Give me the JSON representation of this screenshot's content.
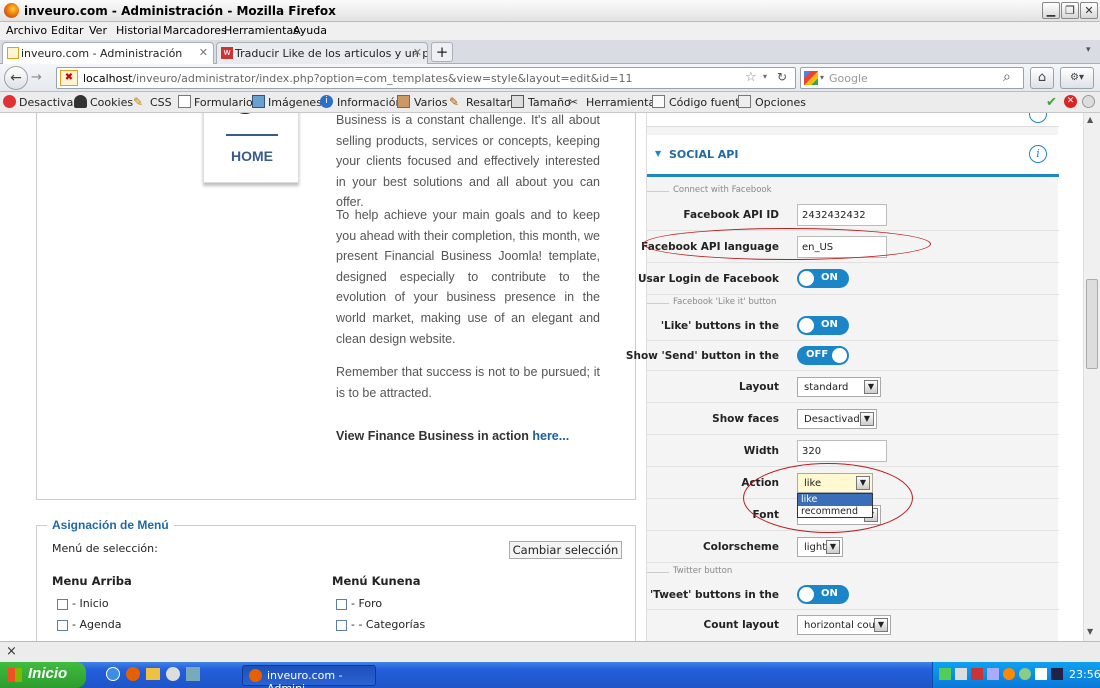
{
  "window": {
    "title": "inveuro.com - Administración - Mozilla Firefox"
  },
  "menubar": [
    "Archivo",
    "Editar",
    "Ver",
    "Historial",
    "Marcadores",
    "Herramientas",
    "Ayuda"
  ],
  "tabs": [
    {
      "label": "inveuro.com - Administración",
      "active": true
    },
    {
      "label": "Traducir Like de los articulos y un par det...",
      "active": false
    }
  ],
  "nav": {
    "url_host": "localhost",
    "url_path": "/inveuro/administrator/index.php?option=com_templates&view=style&layout=edit&id=11",
    "search_placeholder": "Google"
  },
  "toolbar": [
    "Desactivar",
    "Cookies",
    "CSS",
    "Formularios",
    "Imágenes",
    "Información",
    "Varios",
    "Resaltar",
    "Tamaño",
    "Herramientas",
    "Código fuente",
    "Opciones"
  ],
  "left": {
    "home_label": "HOME",
    "para1": "Business is a constant challenge. It's all about selling products, services or concepts, keeping your clients focused and effectively interested in your best solutions and all about you can offer.",
    "para2": "To help achieve your main goals and to keep you ahead with their completion, this month, we present Financial Business Joomla! template, designed especially to contribute to the evolution of your business presence in the world market, making use of an elegant and clean design website.",
    "para3": "Remember that success is not to be pursued; it is to be attracted.",
    "view_text": "View Finance Business in action ",
    "here": "here..."
  },
  "menu_assign": {
    "legend": "Asignación de Menú",
    "select_label": "Menú de selección:",
    "change_button": "Cambiar selección",
    "col1_title": "Menu Arriba",
    "col1_items": [
      "- Inicio",
      "- Agenda"
    ],
    "col2_title": "Menú Kunena",
    "col2_items": [
      "- Foro",
      "- - Categorías"
    ]
  },
  "social": {
    "header": "SOCIAL API",
    "sect_connect": "Connect with Facebook",
    "fb_api_id_label": "Facebook API ID",
    "fb_api_id": "2432432432",
    "fb_lang_label": "Facebook API language",
    "fb_lang": "en_US",
    "fb_login_label": "Usar Login de Facebook",
    "fb_login": "ON",
    "sect_like": "Facebook 'Like it' button",
    "like_buttons_label": "'Like' buttons in the",
    "like_buttons": "ON",
    "send_label": "Show 'Send' button in the",
    "send": "OFF",
    "layout_label": "Layout",
    "layout": "standard",
    "faces_label": "Show faces",
    "faces": "Desactivado",
    "width_label": "Width",
    "width": "320",
    "action_label": "Action",
    "action": "like",
    "action_options": [
      "like",
      "recommend"
    ],
    "font_label": "Font",
    "colorscheme_label": "Colorscheme",
    "colorscheme": "light",
    "sect_twitter": "Twitter button",
    "tweet_label": "'Tweet' buttons in the",
    "tweet": "ON",
    "count_label": "Count layout",
    "count": "horizontal count"
  },
  "statusbar": {
    "close": "×"
  },
  "taskbar": {
    "start": "Inicio",
    "task": "inveuro.com - Admini...",
    "clock": "23:56"
  }
}
